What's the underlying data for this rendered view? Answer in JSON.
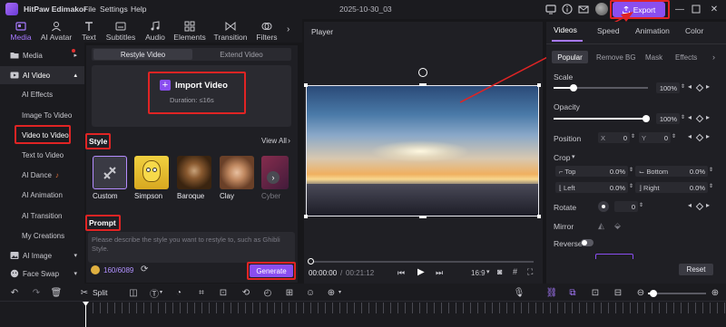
{
  "app": {
    "title": "HitPaw Edimakor",
    "menus": [
      "File",
      "Settings",
      "Help"
    ],
    "project_name": "2025-10-30_03",
    "export_label": "Export"
  },
  "toolbar": {
    "tools": [
      {
        "label": "Media",
        "icon": "media-icon",
        "active": true
      },
      {
        "label": "AI Avatar",
        "icon": "ai-avatar-icon"
      },
      {
        "label": "Text",
        "icon": "text-icon"
      },
      {
        "label": "Subtitles",
        "icon": "subtitles-icon"
      },
      {
        "label": "Audio",
        "icon": "audio-icon"
      },
      {
        "label": "Elements",
        "icon": "elements-icon"
      },
      {
        "label": "Transition",
        "icon": "transition-icon"
      },
      {
        "label": "Filters",
        "icon": "filters-icon"
      }
    ]
  },
  "sidebar": {
    "media": "Media",
    "ai_video": "AI Video",
    "ai_video_items": [
      "AI Effects",
      "Image To Video",
      "Video to Video",
      "Text to Video",
      "AI Dance",
      "AI Animation",
      "AI Transition",
      "My Creations"
    ],
    "ai_image": "AI Image",
    "face_swap": "Face Swap"
  },
  "restyle": {
    "tabs": [
      "Restyle Video",
      "Extend Video"
    ],
    "import_label": "Import Video",
    "duration": "Duration: ≤16s",
    "style_heading": "Style",
    "view_all": "View All",
    "styles": [
      "Custom",
      "Simpson",
      "Baroque",
      "Clay",
      "Cyber"
    ],
    "prompt_heading": "Prompt",
    "prompt_placeholder": "Please describe the style you want to restyle to, such as Ghibli Style.",
    "credits": "160/6089",
    "generate_label": "Generate"
  },
  "player": {
    "label": "Player",
    "current_time": "00:00:00",
    "total_time": "00:21:12",
    "aspect": "16:9"
  },
  "properties": {
    "tabs": [
      "Videos",
      "Speed",
      "Animation",
      "Color"
    ],
    "subtabs": [
      "Popular",
      "Remove BG",
      "Mask",
      "Effects"
    ],
    "scale_label": "Scale",
    "scale_value": "100%",
    "opacity_label": "Opacity",
    "opacity_value": "100%",
    "position_label": "Position",
    "pos_x_label": "X",
    "pos_x": "0",
    "pos_y_label": "Y",
    "pos_y": "0",
    "crop_label": "Crop",
    "crop_top_label": "Top",
    "crop_top": "0.0%",
    "crop_bottom_label": "Bottom",
    "crop_bottom": "0.0%",
    "crop_left_label": "Left",
    "crop_left": "0.0%",
    "crop_right_label": "Right",
    "crop_right": "0.0%",
    "rotate_label": "Rotate",
    "rotate_value": "0",
    "mirror_label": "Mirror",
    "reverse_label": "Reverse",
    "reset_label": "Reset"
  },
  "timeline": {
    "split_label": "Split"
  },
  "colors": {
    "accent": "#8a4ef0",
    "highlight": "#e02424"
  }
}
